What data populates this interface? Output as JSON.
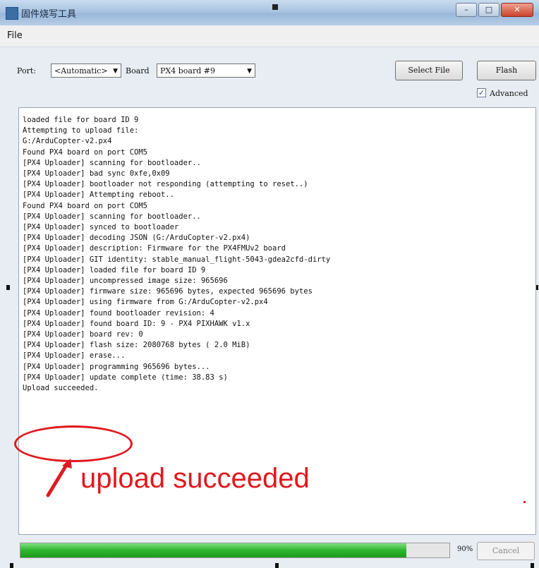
{
  "window": {
    "title": "固件烧写工具"
  },
  "menu": {
    "file": "File"
  },
  "toolbar": {
    "port_label": "Port:",
    "port_value": "<Automatic>",
    "board_label": "Board",
    "board_value": "PX4 board #9",
    "select_file": "Select File",
    "flash": "Flash",
    "advanced": "Advanced",
    "advanced_checked": true
  },
  "log": {
    "lines": [
      "loaded file for board ID 9",
      "Attempting to upload file:",
      "G:/ArduCopter-v2.px4",
      "Found PX4 board on port COM5",
      "[PX4 Uploader] scanning for bootloader..",
      "[PX4 Uploader] bad sync 0xfe,0x09",
      "[PX4 Uploader] bootloader not responding (attempting to reset..)",
      "[PX4 Uploader] Attempting reboot..",
      "Found PX4 board on port COM5",
      "[PX4 Uploader] scanning for bootloader..",
      "[PX4 Uploader] synced to bootloader",
      "[PX4 Uploader] decoding JSON (G:/ArduCopter-v2.px4)",
      "[PX4 Uploader] description: Firmware for the PX4FMUv2 board",
      "[PX4 Uploader] GIT identity: stable_manual_flight-5043-gdea2cfd-dirty",
      "[PX4 Uploader] loaded file for board ID 9",
      "[PX4 Uploader] uncompressed image size: 965696",
      "[PX4 Uploader] firmware size: 965696 bytes, expected 965696 bytes",
      "[PX4 Uploader] using firmware from G:/ArduCopter-v2.px4",
      "[PX4 Uploader] found bootloader revision: 4",
      "[PX4 Uploader] found board ID: 9 - PX4 PIXHAWK v1.x",
      "[PX4 Uploader] board rev: 0",
      "[PX4 Uploader] flash size: 2080768 bytes ( 2.0 MiB)",
      "[PX4 Uploader] erase...",
      "[PX4 Uploader] programming 965696 bytes...",
      "[PX4 Uploader] update complete (time: 38.83 s)",
      "Upload succeeded."
    ]
  },
  "annotation": {
    "text": "upload succeeded",
    "color": "#e0191e"
  },
  "progress": {
    "value": 0.9,
    "label": "90%"
  },
  "cancel": "Cancel"
}
